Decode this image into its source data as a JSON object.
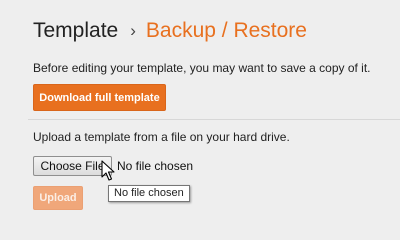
{
  "header": {
    "root_label": "Template",
    "separator": "›",
    "current_label": "Backup / Restore"
  },
  "backup": {
    "description": "Before editing your template, you may want to save a copy of it.",
    "download_label": "Download full template"
  },
  "restore": {
    "description": "Upload a template from a file on your hard drive.",
    "choose_file_label": "Choose File",
    "file_status": "No file chosen",
    "tooltip": "No file chosen",
    "upload_label": "Upload",
    "upload_enabled": false
  },
  "colors": {
    "accent": "#e8701f",
    "accent_disabled": "#f0a77a",
    "background": "#eeeeee"
  },
  "icons": {
    "cursor": "arrow-cursor-icon"
  }
}
